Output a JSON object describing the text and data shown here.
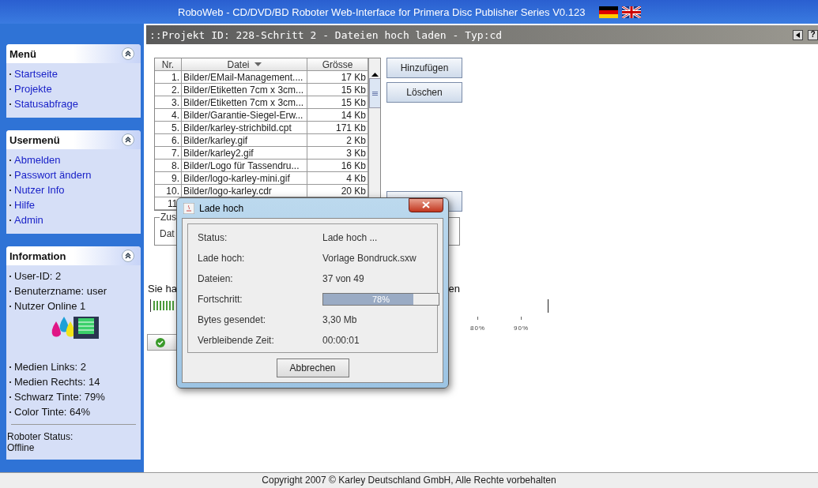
{
  "app_title": "RoboWeb - CD/DVD/BD Roboter Web-Interface for Primera Disc Publisher Series V0.123",
  "sidebar": {
    "panels": [
      {
        "kind": "links",
        "title": "Menü",
        "items": [
          "Startseite",
          "Projekte",
          "Statusabfrage"
        ]
      },
      {
        "kind": "links",
        "title": "Usermenü",
        "items": [
          "Abmelden",
          "Passwort ändern",
          "Nutzer Info",
          "Hilfe",
          "Admin"
        ]
      },
      {
        "kind": "info",
        "title": "Information",
        "items": [
          "User-ID: 2",
          "Benuterzname: user",
          "Nutzer Online 1"
        ],
        "items_after": [
          "Medien Links: 2",
          "Medien Rechts: 14",
          "Schwarz Tinte: 79%",
          "Color Tinte: 64%"
        ],
        "status_label": "Roboter Status:",
        "status_value": "Offline"
      }
    ]
  },
  "page": {
    "title": "::Projekt ID: 228-Schritt 2 - Dateien hoch laden - Typ:cd",
    "help_button": "?"
  },
  "file_table": {
    "columns": [
      "Nr.",
      "Datei",
      "Grösse"
    ],
    "rows": [
      {
        "nr": "1.",
        "file": "Bilder/EMail-Management....",
        "size": "17 Kb"
      },
      {
        "nr": "2.",
        "file": "Bilder/Etiketten 7cm x 3cm...",
        "size": "15 Kb"
      },
      {
        "nr": "3.",
        "file": "Bilder/Etiketten 7cm x 3cm...",
        "size": "15 Kb"
      },
      {
        "nr": "4.",
        "file": "Bilder/Garantie-Siegel-Erw...",
        "size": "14 Kb"
      },
      {
        "nr": "5.",
        "file": "Bilder/karley-strichbild.cpt",
        "size": "171 Kb"
      },
      {
        "nr": "6.",
        "file": "Bilder/karley.gif",
        "size": "2 Kb"
      },
      {
        "nr": "7.",
        "file": "Bilder/karley2.gif",
        "size": "3 Kb"
      },
      {
        "nr": "8.",
        "file": "Bilder/Logo für Tassendru...",
        "size": "16 Kb"
      },
      {
        "nr": "9.",
        "file": "Bilder/logo-karley-mini.gif",
        "size": "4 Kb"
      },
      {
        "nr": "10.",
        "file": "Bilder/logo-karley.cdr",
        "size": "20 Kb"
      }
    ],
    "partial_row": "11"
  },
  "buttons": [
    "Hinzufügen",
    "Löschen"
  ],
  "details_group": {
    "legend": "Zus",
    "row_label": "Dat"
  },
  "notice": {
    "start": "Sie ha",
    "end": "en"
  },
  "scale_ticks": [
    "80%",
    "90%"
  ],
  "dialog": {
    "title": "Lade hoch",
    "rows": [
      {
        "kind": "text",
        "label": "Status:",
        "value": "Lade hoch ..."
      },
      {
        "kind": "text",
        "label": "Lade hoch:",
        "value": "Vorlage Bondruck.sxw"
      },
      {
        "kind": "text",
        "label": "Dateien:",
        "value": "37 von 49"
      },
      {
        "kind": "progress",
        "label": "Fortschritt:",
        "value": "78%",
        "level": 0.78
      },
      {
        "kind": "text",
        "label": "Bytes gesendet:",
        "value": "3,30 Mb"
      },
      {
        "kind": "text",
        "label": "Verbleibende Zeit:",
        "value": "00:00:01"
      }
    ],
    "cancel": "Abbrechen"
  },
  "footer": "Copyright 2007 © Karley Deutschland GmbH, Alle Rechte vorbehalten"
}
